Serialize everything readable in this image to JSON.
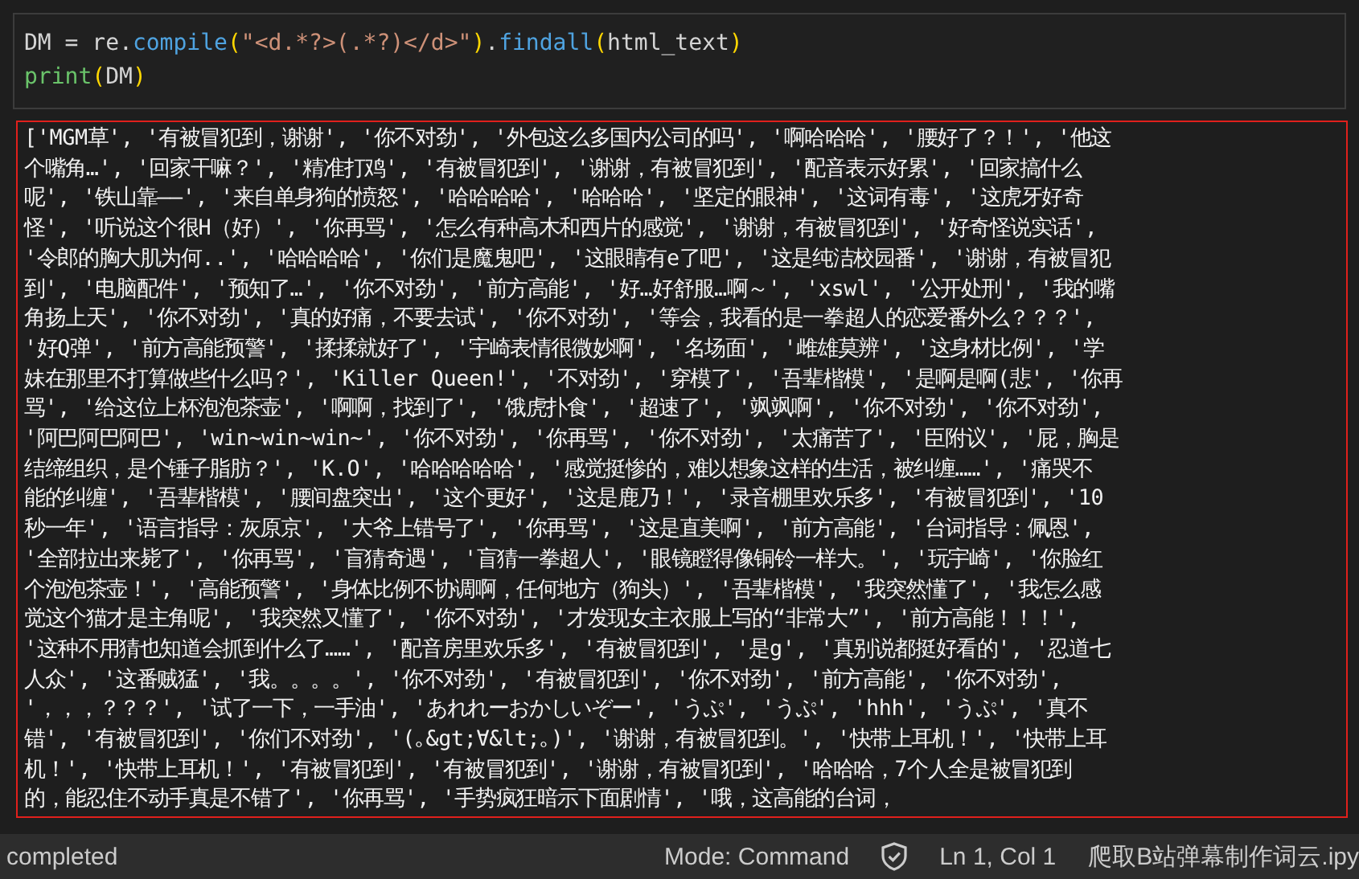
{
  "code_cell": {
    "lines": [
      [
        {
          "text": "DM ",
          "kind": "name"
        },
        {
          "text": "=",
          "kind": "operator"
        },
        {
          "text": " re.",
          "kind": "name"
        },
        {
          "text": "compile",
          "kind": "function"
        },
        {
          "text": "(",
          "kind": "paren"
        },
        {
          "text": "\"<d.*?>(.*?)</d>\"",
          "kind": "string"
        },
        {
          "text": ")",
          "kind": "paren"
        },
        {
          "text": ".",
          "kind": "name"
        },
        {
          "text": "findall",
          "kind": "function"
        },
        {
          "text": "(",
          "kind": "paren"
        },
        {
          "text": "html_text",
          "kind": "name"
        },
        {
          "text": ")",
          "kind": "paren"
        }
      ],
      [
        {
          "text": "print",
          "kind": "builtin"
        },
        {
          "text": "(",
          "kind": "paren"
        },
        {
          "text": "DM",
          "kind": "name"
        },
        {
          "text": ")",
          "kind": "paren"
        }
      ]
    ]
  },
  "output": {
    "lines": [
      "['MGM草', '有被冒犯到，谢谢', '你不对劲', '外包这么多国内公司的吗', '啊哈哈哈', '腰好了？！', '他这",
      "个嘴角…', '回家干嘛？', '精准打鸡', '有被冒犯到', '谢谢，有被冒犯到', '配音表示好累', '回家搞什么",
      "呢', '铁山靠——', '来自单身狗的愤怒', '哈哈哈哈', '哈哈哈', '坚定的眼神', '这词有毒', '这虎牙好奇",
      "怪', '听说这个很H（好）', '你再骂', '怎么有种高木和西片的感觉', '谢谢，有被冒犯到', '好奇怪说实话',",
      "'令郎的胸大肌为何..', '哈哈哈哈', '你们是魔鬼吧', '这眼睛有e了吧', '这是纯洁校园番', '谢谢，有被冒犯",
      "到', '电脑配件', '预知了…', '你不对劲', '前方高能', '好…好舒服…啊～', 'xswl', '公开处刑', '我的嘴",
      "角扬上天', '你不对劲', '真的好痛，不要去试', '你不对劲', '等会，我看的是一拳超人的恋爱番外么？？？',",
      "'好Q弹', '前方高能预警', '揉揉就好了', '宇崎表情很微妙啊', '名场面', '雌雄莫辨', '这身材比例', '学",
      "妹在那里不打算做些什么吗？', 'Killer Queen!', '不对劲', '穿模了', '吾辈楷模', '是啊是啊(悲', '你再",
      "骂', '给这位上杯泡泡茶壶', '啊啊，找到了', '饿虎扑食', '超速了', '飒飒啊', '你不对劲', '你不对劲',",
      "'阿巴阿巴阿巴', 'win~win~win~', '你不对劲', '你再骂', '你不对劲', '太痛苦了', '臣附议', '屁，胸是",
      "结缔组织，是个锤子脂肪？', 'K.O', '哈哈哈哈哈', '感觉挺惨的，难以想象这样的生活，被纠缠……', '痛哭不",
      "能的纠缠', '吾辈楷模', '腰间盘突出', '这个更好', '这是鹿乃！', '录音棚里欢乐多', '有被冒犯到', '10",
      "秒一年', '语言指导：灰原京', '大爷上错号了', '你再骂', '这是直美啊', '前方高能', '台词指导：佩恩',",
      "'全部拉出来毙了', '你再骂', '盲猜奇遇', '盲猜一拳超人', '眼镜瞪得像铜铃一样大。', '玩宇崎', '你脸红",
      "个泡泡茶壶！', '高能预警', '身体比例不协调啊，任何地方（狗头）', '吾辈楷模', '我突然懂了', '我怎么感",
      "觉这个猫才是主角呢', '我突然又懂了', '你不对劲', '才发现女主衣服上写的“非常大”', '前方高能！！！',",
      "'这种不用猜也知道会抓到什么了……', '配音房里欢乐多', '有被冒犯到', '是g', '真别说都挺好看的', '忍道七",
      "人众', '这番贼猛', '我。。。。', '你不对劲', '有被冒犯到', '你不对劲', '前方高能', '你不对劲',",
      "'，，，？？？', '试了一下，一手油', 'あれれーおかしいぞー', 'うぷ', 'うぷ', 'hhh', 'うぷ', '真不",
      "错', '有被冒犯到', '你们不对劲', '(｡&gt;∀&lt;｡)', '谢谢，有被冒犯到。', '快带上耳机！', '快带上耳",
      "机！', '快带上耳机！', '有被冒犯到', '有被冒犯到', '谢谢，有被冒犯到', '哈哈哈，7个人全是被冒犯到",
      "的，能忍住不动手真是不错了', '你再骂', '手势疯狂暗示下面剧情', '哦，这高能的台词，"
    ]
  },
  "status_bar": {
    "kernel_status": "completed",
    "mode": "Mode: Command",
    "cursor": "Ln 1, Col 1",
    "filename": "爬取B站弹幕制作词云.ipy"
  }
}
